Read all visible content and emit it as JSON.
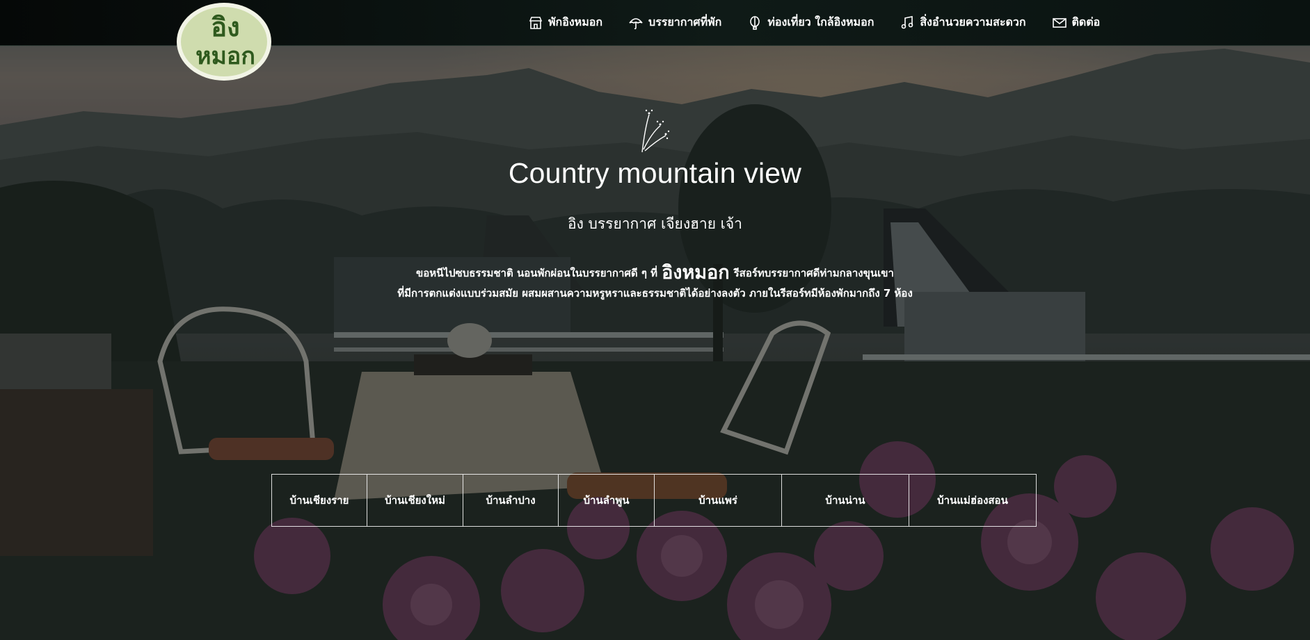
{
  "nav": {
    "items": [
      {
        "label": "พักอิงหมอก",
        "icon": "store-icon"
      },
      {
        "label": "บรรยากาศที่พัก",
        "icon": "umbrella-icon"
      },
      {
        "label": "ท่องเที่ยว ใกล้อิงหมอก",
        "icon": "balloon-icon"
      },
      {
        "label": "สิ่งอำนวยความสะดวก",
        "icon": "music-note-icon"
      },
      {
        "label": "ติดต่อ",
        "icon": "mail-icon"
      }
    ]
  },
  "logo": {
    "text_line1": "อิง",
    "text_line2": "หมอก"
  },
  "hero": {
    "title": "Country mountain view",
    "subtitle": "อิง บรรยากาศ เจียงฮาย เจ้า",
    "desc_prefix": "ขอหนีไปซบธรรมชาติ นอนพักผ่อนในบรรยากาศดี ๆ ที่",
    "desc_brand": "อิงหมอก",
    "desc_suffix": "รีสอร์ทบรรยากาศดีท่ามกลางขุนเขา",
    "desc_line2": "ที่มีการตกแต่งแบบร่วมสมัย ผสมผสานความหรูหราและธรรมชาติได้อย่างลงตัว ภายในรีสอร์ทมีห้องพักมากถึง 7 ห้อง"
  },
  "tabs": [
    {
      "label": "บ้านเชียงราย"
    },
    {
      "label": "บ้านเชียงใหม่"
    },
    {
      "label": "บ้านลำปาง"
    },
    {
      "label": "บ้านลำพูน"
    },
    {
      "label": "บ้านแพร่"
    },
    {
      "label": "บ้านน่าน"
    },
    {
      "label": "บ้านแม่ฮ่องสอน"
    }
  ],
  "colors": {
    "overlay": "#1e2523",
    "accent": "#cfdcae",
    "logo_text": "#2f5a1e"
  }
}
